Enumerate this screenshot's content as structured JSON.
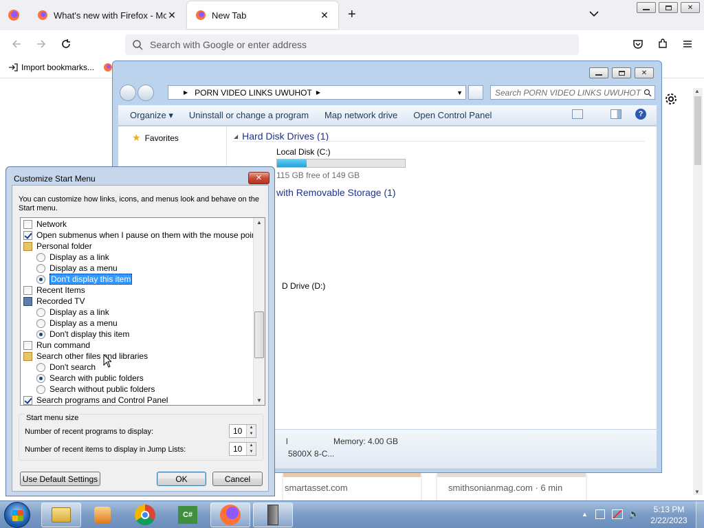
{
  "firefox": {
    "tabs": [
      {
        "label": "What's new with Firefox - More"
      },
      {
        "label": "New Tab"
      }
    ],
    "search_placeholder": "Search with Google or enter address",
    "bookmark_import": "Import bookmarks...",
    "cards": [
      {
        "text": "smartasset.com"
      },
      {
        "text": "smithsonianmag.com · 6 min"
      }
    ]
  },
  "explorer": {
    "breadcrumb": "PORN VIDEO LINKS  UWUHOT",
    "search_placeholder": "Search PORN VIDEO LINKS  UWUHOT",
    "toolbar": {
      "organize": "Organize",
      "uninstall": "Uninstall or change a program",
      "map_drive": "Map network drive",
      "control_panel": "Open Control Panel"
    },
    "sidebar": {
      "favorites": "Favorites"
    },
    "groups": {
      "hdd": "Hard Disk Drives (1)",
      "removable": "with Removable Storage (1)"
    },
    "local_disk": {
      "name": "Local Disk (C:)",
      "free": "115 GB free of 149 GB",
      "used_fraction": 0.23
    },
    "dvd": {
      "name": "D Drive (D:)"
    },
    "details": {
      "memory": "Memory: 4.00 GB",
      "cpu": "5800X 8-C...",
      "left_char": "l"
    }
  },
  "dialog": {
    "title": "Customize Start Menu",
    "description": "You can customize how links, icons, and menus look and behave on the Start menu.",
    "items": [
      {
        "text": "Network"
      },
      {
        "text": "Open submenus when I pause on them with the mouse pointer"
      },
      {
        "text": "Personal folder"
      },
      {
        "text": "Display as a link"
      },
      {
        "text": "Display as a menu"
      },
      {
        "text": "Don't display this item"
      },
      {
        "text": "Recent Items"
      },
      {
        "text": "Recorded TV"
      },
      {
        "text": "Display as a link"
      },
      {
        "text": "Display as a menu"
      },
      {
        "text": "Don't display this item"
      },
      {
        "text": "Run command"
      },
      {
        "text": "Search other files and libraries"
      },
      {
        "text": "Don't search"
      },
      {
        "text": "Search with public folders"
      },
      {
        "text": "Search without public folders"
      },
      {
        "text": "Search programs and Control Panel"
      }
    ],
    "size_group": "Start menu size",
    "recent_programs_label": "Number of recent programs to display:",
    "recent_programs_value": "10",
    "recent_items_label": "Number of recent items to display in Jump Lists:",
    "recent_items_value": "10",
    "default_button": "Use Default Settings",
    "ok_button": "OK",
    "cancel_button": "Cancel"
  },
  "taskbar": {
    "time": "5:13 PM",
    "date": "2/22/2023"
  }
}
